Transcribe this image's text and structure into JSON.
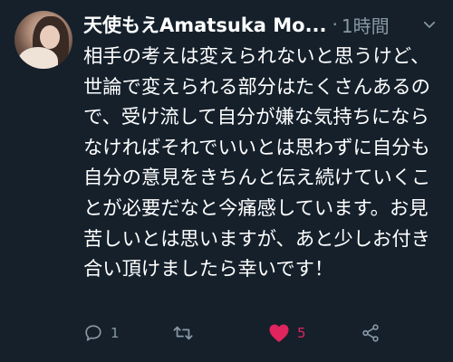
{
  "tweet": {
    "author_name": "天使もえAmatsuka Mo...",
    "separator": "·",
    "time": "1時間",
    "text": "相手の考えは変えられないと思うけど、世論で変えられる部分はたくさんあるので、受け流して自分が嫌な気持ちにならなければそれでいいとは思わずに自分も自分の意見をきちんと伝え続けていくことが必要だなと今痛感しています。お見苦しいとは思いますが、あと少しお付き合い頂けましたら幸いです！"
  },
  "actions": {
    "reply_count": "1",
    "retweet_count": "",
    "like_count": "5",
    "liked": true
  },
  "colors": {
    "background": "#15202b",
    "text": "#ffffff",
    "muted": "#8899a6",
    "like": "#e0245e"
  },
  "icons": {
    "reply": "speech-bubble-icon",
    "retweet": "retweet-arrows-icon",
    "like": "heart-icon",
    "share": "share-nodes-icon",
    "more": "chevron-down-icon"
  }
}
